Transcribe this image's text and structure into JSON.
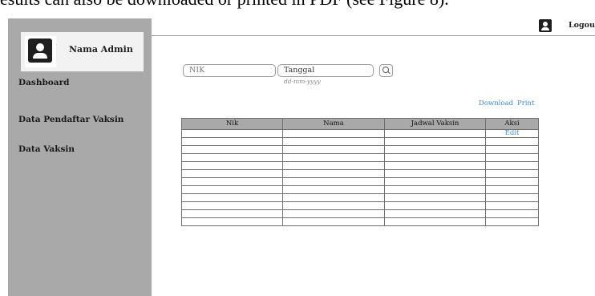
{
  "caption_text": "esults can also be downloaded or printed in PDF (see Figure 8).",
  "sidebar": {
    "admin_name": "Nama Admin",
    "items": [
      {
        "label": "Dashboard"
      },
      {
        "label": "Data Pendaftar Vaksin"
      },
      {
        "label": "Data Vaksin"
      }
    ]
  },
  "header": {
    "logout_label": "Logout"
  },
  "filters": {
    "nik_placeholder": "NIK",
    "date_label": "Tanggal",
    "date_hint": "dd-mm-yyyy"
  },
  "actions": {
    "download_label": "Download",
    "print_label": "Print"
  },
  "table": {
    "columns": [
      "Nik",
      "Nama",
      "Jadwal Vaksin",
      "Aksi"
    ],
    "edit_label": "Edit"
  },
  "colors": {
    "sidebar_bg": "#a9a9a9",
    "link": "#3b8fd9"
  }
}
